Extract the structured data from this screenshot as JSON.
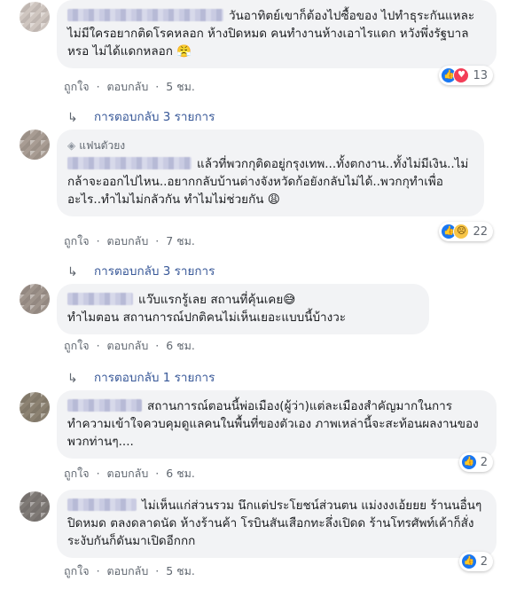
{
  "comments": [
    {
      "text": "วันอาทิตย์เขาก็ต้องไปซื้อของ ไปทำธุระกันแหละ ไม่มีใครอยากติดโรคหลอก ห้างปิดหมด คนทำงานห้างเอาไรแดก หวังพึ่งรัฐบาลหรอ ไม่ได้แดกหลอก 😤",
      "like_label": "ถูกใจ",
      "reply_label": "ตอบกลับ",
      "time": "5 ชม.",
      "reaction_count": "13",
      "replies_label": "การตอบกลับ 3 รายการ"
    },
    {
      "badge": "แฟนตัวยง",
      "text": "แล้วที่พวกกุติดอยู่กรุงเทพ...ทั้งตกงาน..ทั้งไม่มีเงิน..ไม่กล้าจะออกไปไหน..อยากกลับบ้านต่างจังหวัดก้อยังกลับไม่ได้..พวกกุทำเพื่ออะไร..ทำไมไม่กลัวกัน ทำไมไม่ช่วยกัน 😩",
      "like_label": "ถูกใจ",
      "reply_label": "ตอบกลับ",
      "time": "7 ชม.",
      "reaction_count": "22",
      "replies_label": "การตอบกลับ 3 รายการ"
    },
    {
      "text_line1": "แว๊บแรกรู้เลย สถานที่คุ้นเคย😅",
      "text_line2": "ทำไมตอน สถานการณ์ปกติคนไม่เห็นเยอะแบบนี้บ้างวะ",
      "like_label": "ถูกใจ",
      "reply_label": "ตอบกลับ",
      "time": "6 ชม.",
      "replies_label": "การตอบกลับ 1 รายการ"
    },
    {
      "text": "สถานการณ์ตอนนี้พ่อเมือง(ผู้ว่า)แต่ละเมืองสำคัญมากในการทำความเข้าใจควบคุมดูแลคนในพื้นที่ของตัวเอง ภาพเหล่านี้จะสะท้อนผลงานของพวกท่านๆ....",
      "like_label": "ถูกใจ",
      "reply_label": "ตอบกลับ",
      "time": "6 ชม.",
      "reaction_count": "2"
    },
    {
      "text": "ไม่เห็นแก่ส่วนรวม นึกแต่ประโยชน์ส่วนตน แม่งงงเอ้ยยย ร้านนอื่นๆปิดหมด ตลงดลาดนัด ห้างร้านค้า โรบินสันเสือกทะลึ่งเปิดด ร้านโทรศัพท์เค้าก็สั่งระงับกันก็ดันมาเปิดอีกกก",
      "like_label": "ถูกใจ",
      "reply_label": "ตอบกลับ",
      "time": "5 ชม.",
      "reaction_count": "2"
    }
  ],
  "separator": "·",
  "icons": {
    "like": "like-icon",
    "love": "love-icon",
    "sad": "sad-icon",
    "reply_arrow": "reply-arrow-icon",
    "badge": "diamond-icon"
  }
}
